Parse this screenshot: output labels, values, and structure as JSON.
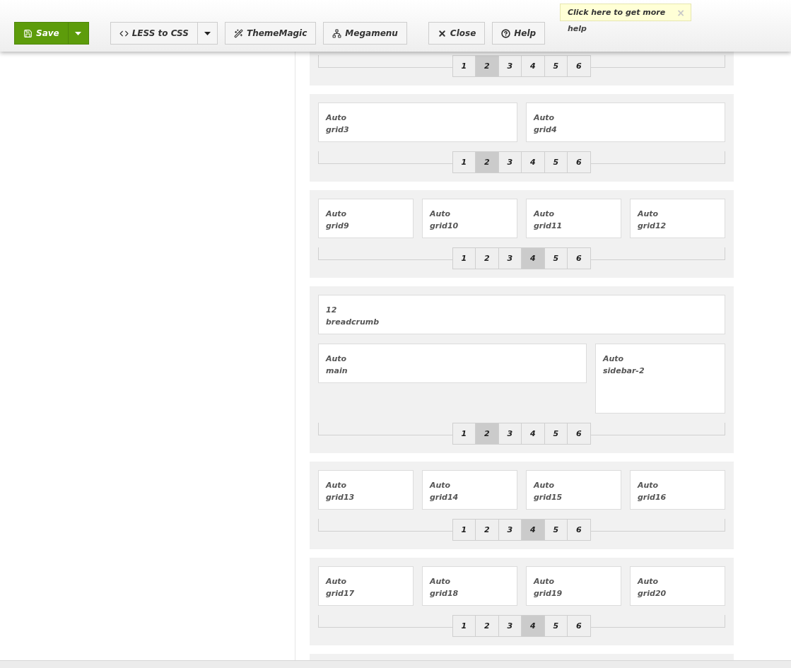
{
  "toolbar": {
    "groups": [
      [
        {
          "label": "Save",
          "kind": "primary",
          "split": true
        }
      ],
      [
        {
          "label": "LESS to CSS",
          "kind": "default",
          "split": true
        },
        {
          "label": "ThemeMagic",
          "kind": "default",
          "split": false
        },
        {
          "label": "Megamenu",
          "kind": "default",
          "split": false
        }
      ],
      [
        {
          "label": "Close",
          "kind": "default",
          "split": false
        },
        {
          "label": "Help",
          "kind": "default",
          "split": false
        }
      ]
    ]
  },
  "tooltip": {
    "text": "Click here to get more",
    "continuation": "help",
    "close": "×"
  },
  "sections": [
    {
      "kind": "grid",
      "pages": [
        {
          "label": "1",
          "selected": false
        },
        {
          "label": "2",
          "selected": true
        },
        {
          "label": "3",
          "selected": false
        },
        {
          "label": "4",
          "selected": false
        },
        {
          "label": "5",
          "selected": false
        },
        {
          "label": "6",
          "selected": false
        }
      ]
    },
    {
      "kind": "grid",
      "rows": [
        [
          {
            "size": "Auto",
            "name": "grid3"
          },
          {
            "size": "Auto",
            "name": "grid4"
          }
        ]
      ],
      "pages": [
        {
          "label": "1",
          "selected": false
        },
        {
          "label": "2",
          "selected": true
        },
        {
          "label": "3",
          "selected": false
        },
        {
          "label": "4",
          "selected": false
        },
        {
          "label": "5",
          "selected": false
        },
        {
          "label": "6",
          "selected": false
        }
      ]
    },
    {
      "kind": "grid",
      "rows": [
        [
          {
            "size": "Auto",
            "name": "grid9"
          },
          {
            "size": "Auto",
            "name": "grid10"
          },
          {
            "size": "Auto",
            "name": "grid11"
          },
          {
            "size": "Auto",
            "name": "grid12"
          }
        ]
      ],
      "pages": [
        {
          "label": "1",
          "selected": false
        },
        {
          "label": "2",
          "selected": false
        },
        {
          "label": "3",
          "selected": false
        },
        {
          "label": "4",
          "selected": true
        },
        {
          "label": "5",
          "selected": false
        },
        {
          "label": "6",
          "selected": false
        }
      ]
    },
    {
      "kind": "content",
      "rows": [
        [
          {
            "size": "12",
            "name": "breadcrumb"
          }
        ],
        [
          {
            "size": "Auto",
            "name": "main"
          },
          {
            "size": "Auto",
            "name": "sidebar-2"
          }
        ]
      ],
      "pages": [
        {
          "label": "1",
          "selected": false
        },
        {
          "label": "2",
          "selected": true
        },
        {
          "label": "3",
          "selected": false
        },
        {
          "label": "4",
          "selected": false
        },
        {
          "label": "5",
          "selected": false
        },
        {
          "label": "6",
          "selected": false
        }
      ]
    },
    {
      "kind": "grid",
      "rows": [
        [
          {
            "size": "Auto",
            "name": "grid13"
          },
          {
            "size": "Auto",
            "name": "grid14"
          },
          {
            "size": "Auto",
            "name": "grid15"
          },
          {
            "size": "Auto",
            "name": "grid16"
          }
        ]
      ],
      "pages": [
        {
          "label": "1",
          "selected": false
        },
        {
          "label": "2",
          "selected": false
        },
        {
          "label": "3",
          "selected": false
        },
        {
          "label": "4",
          "selected": true
        },
        {
          "label": "5",
          "selected": false
        },
        {
          "label": "6",
          "selected": false
        }
      ]
    },
    {
      "kind": "grid",
      "rows": [
        [
          {
            "size": "Auto",
            "name": "grid17"
          },
          {
            "size": "Auto",
            "name": "grid18"
          },
          {
            "size": "Auto",
            "name": "grid19"
          },
          {
            "size": "Auto",
            "name": "grid20"
          }
        ]
      ],
      "pages": [
        {
          "label": "1",
          "selected": false
        },
        {
          "label": "2",
          "selected": false
        },
        {
          "label": "3",
          "selected": false
        },
        {
          "label": "4",
          "selected": true
        },
        {
          "label": "5",
          "selected": false
        },
        {
          "label": "6",
          "selected": false
        }
      ]
    },
    {
      "kind": "grid"
    }
  ]
}
